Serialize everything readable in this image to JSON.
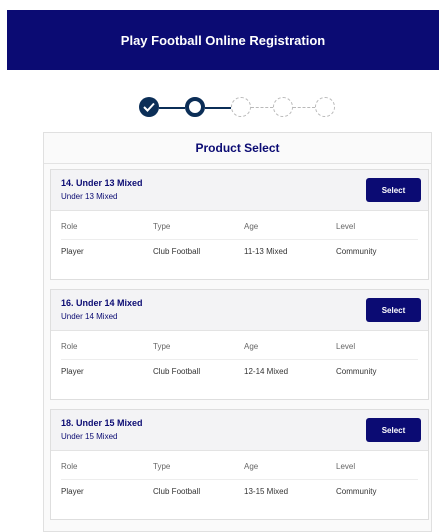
{
  "header": {
    "title": "Play Football Online Registration"
  },
  "stepper": {
    "completed": 1,
    "current": 2,
    "total": 5
  },
  "panel": {
    "title": "Product Select"
  },
  "columns": [
    "Role",
    "Type",
    "Age",
    "Level"
  ],
  "products": [
    {
      "name": "14. Under 13 Mixed",
      "subtitle": "Under 13 Mixed",
      "button": "Select",
      "values": [
        "Player",
        "Club Football",
        "11-13 Mixed",
        "Community"
      ]
    },
    {
      "name": "16. Under 14 Mixed",
      "subtitle": "Under 14 Mixed",
      "button": "Select",
      "values": [
        "Player",
        "Club Football",
        "12-14 Mixed",
        "Community"
      ]
    },
    {
      "name": "18. Under 15 Mixed",
      "subtitle": "Under 15 Mixed",
      "button": "Select",
      "values": [
        "Player",
        "Club Football",
        "13-15 Mixed",
        "Community"
      ]
    }
  ]
}
